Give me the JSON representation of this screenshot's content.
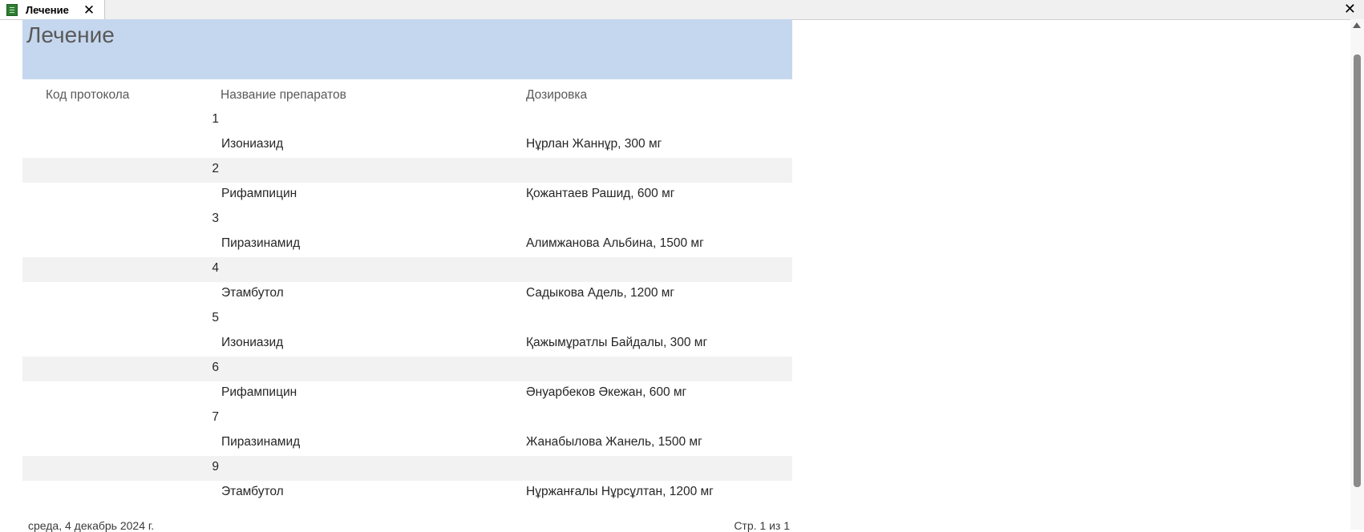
{
  "tab": {
    "label": "Лечение",
    "close_glyph": "✕"
  },
  "window": {
    "close_glyph": "✕"
  },
  "report": {
    "title": "Лечение",
    "headers": {
      "code": "Код протокола",
      "drug": "Название препаратов",
      "dose": "Дозировка"
    },
    "rows": [
      {
        "code": "1",
        "drug": "Изониазид",
        "dose": "Нұрлан Жаннұр, 300 мг"
      },
      {
        "code": "2",
        "drug": "Рифампицин",
        "dose": "Қожантаев Рашид, 600 мг"
      },
      {
        "code": "3",
        "drug": "Пиразинамид",
        "dose": "Алимжанова Альбина, 1500 мг"
      },
      {
        "code": "4",
        "drug": "Этамбутол",
        "dose": "Садыкова Адель, 1200 мг"
      },
      {
        "code": "5",
        "drug": "Изониазид",
        "dose": "Қажымұратлы Байдалы, 300 мг"
      },
      {
        "code": "6",
        "drug": "Рифампицин",
        "dose": "Әнуарбеков Әкежан, 600 мг"
      },
      {
        "code": "7",
        "drug": "Пиразинамид",
        "dose": "Жанабылова Жанель, 1500 мг"
      },
      {
        "code": "9",
        "drug": "Этамбутол",
        "dose": "Нұржанғалы Нұрсұлтан,  1200 мг"
      }
    ],
    "footer": {
      "date": "среда, 4 декабрь 2024 г.",
      "page": "Стр. 1 из 1"
    }
  },
  "colors": {
    "header_band": "#c5d7ee",
    "alt_band": "#f2f2f2"
  },
  "icons": {
    "tab_icon": "report-icon",
    "close": "close-icon",
    "scroll_up": "arrow-up-icon"
  }
}
